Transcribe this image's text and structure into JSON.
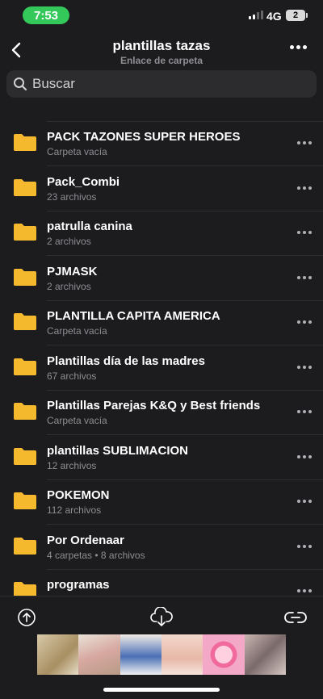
{
  "status_bar": {
    "time": "7:53",
    "network": "4G",
    "battery": "2"
  },
  "header": {
    "title": "plantillas tazas",
    "subtitle": "Enlace de carpeta"
  },
  "search": {
    "placeholder": "Buscar"
  },
  "folders": [
    {
      "name": "PACK TAZONES SUPER HEROES",
      "meta": "Carpeta vacía"
    },
    {
      "name": "Pack_Combi",
      "meta": "23 archivos"
    },
    {
      "name": "patrulla canina",
      "meta": "2 archivos"
    },
    {
      "name": "PJMASK",
      "meta": "2 archivos"
    },
    {
      "name": "PLANTILLA CAPITA AMERICA",
      "meta": "Carpeta vacía"
    },
    {
      "name": "Plantillas día de las madres",
      "meta": "67 archivos"
    },
    {
      "name": "Plantillas Parejas K&Q y Best friends",
      "meta": "Carpeta vacía"
    },
    {
      "name": "plantillas SUBLIMACION",
      "meta": "12 archivos"
    },
    {
      "name": "POKEMON",
      "meta": "112 archivos"
    },
    {
      "name": "Por Ordenaar",
      "meta": "4 carpetas • 8 archivos"
    },
    {
      "name": "programas",
      "meta": ""
    }
  ],
  "toolbar": {
    "upload_icon": "upload-icon",
    "download_icon": "cloud-download-icon",
    "link_icon": "link-icon"
  },
  "colors": {
    "folder": "#f5b82e",
    "background": "#1c1c1e",
    "time_pill": "#34c759"
  }
}
